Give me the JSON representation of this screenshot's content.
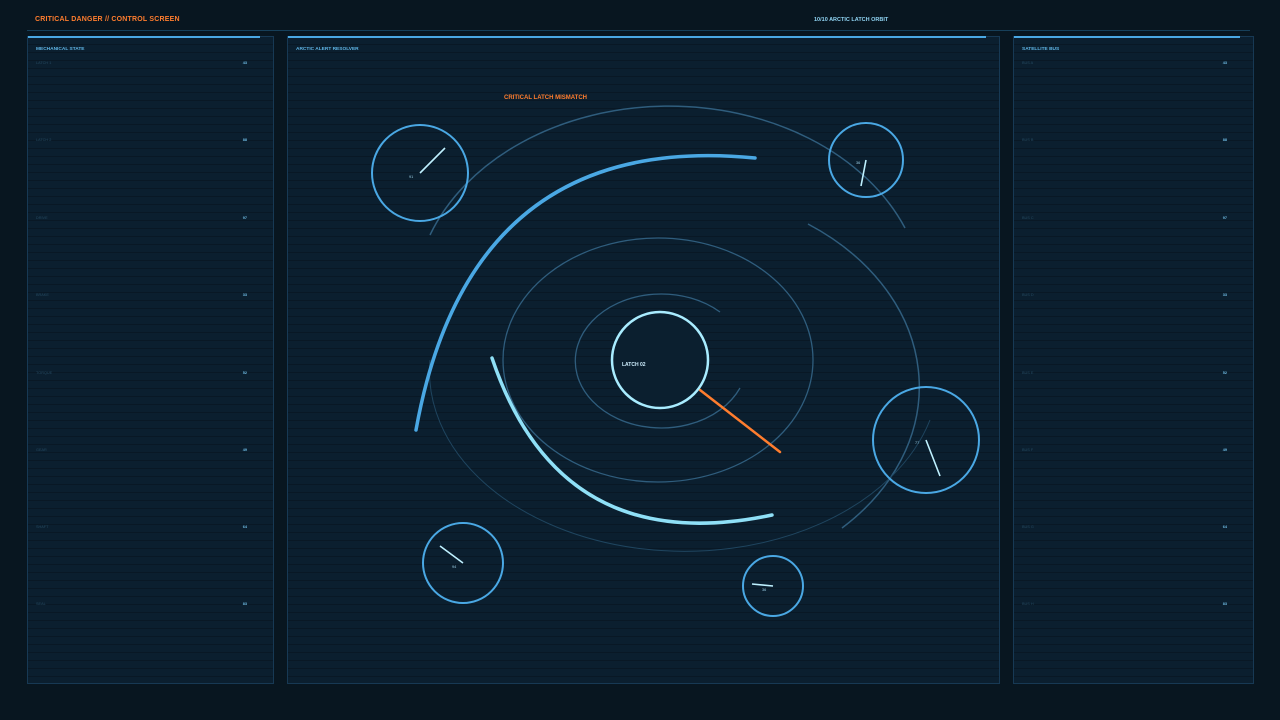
{
  "header": {
    "title": "CRITICAL DANGER // CONTROL SCREEN",
    "status": "10/10  ARCTIC LATCH ORBIT"
  },
  "left_panel": {
    "title": "MECHANICAL STATE",
    "rows": [
      {
        "label": "LATCH 1",
        "value": "43"
      },
      {
        "label": "LATCH 2",
        "value": "88"
      },
      {
        "label": "DRIVE",
        "value": "97"
      },
      {
        "label": "BRAKE",
        "value": "33"
      },
      {
        "label": "TORQUE",
        "value": "52"
      },
      {
        "label": "GEAR",
        "value": "49"
      },
      {
        "label": "SHAFT",
        "value": "64"
      },
      {
        "label": "SEAL",
        "value": "83"
      }
    ]
  },
  "center_panel": {
    "title": "ARCTIC ALERT RESOLVER",
    "alert": "CRITICAL LATCH MISMATCH",
    "core_label": "LATCH 02",
    "dials": [
      {
        "id": "tl",
        "label": "91"
      },
      {
        "id": "tr",
        "label": "36"
      },
      {
        "id": "r",
        "label": "77"
      },
      {
        "id": "bl",
        "label": "94"
      },
      {
        "id": "b",
        "label": "36"
      }
    ]
  },
  "right_panel": {
    "title": "SATELLITE BUS",
    "rows": [
      {
        "label": "BUS A",
        "value": "43"
      },
      {
        "label": "BUS B",
        "value": "88"
      },
      {
        "label": "BUS C",
        "value": "97"
      },
      {
        "label": "BUS D",
        "value": "33"
      },
      {
        "label": "BUS E",
        "value": "52"
      },
      {
        "label": "BUS F",
        "value": "49"
      },
      {
        "label": "BUS G",
        "value": "64"
      },
      {
        "label": "BUS H",
        "value": "83"
      }
    ]
  },
  "colors": {
    "background": "#081620",
    "accent": "#4aa8e4",
    "alert": "#ff7d2e",
    "highlight": "#8fe0f7"
  }
}
